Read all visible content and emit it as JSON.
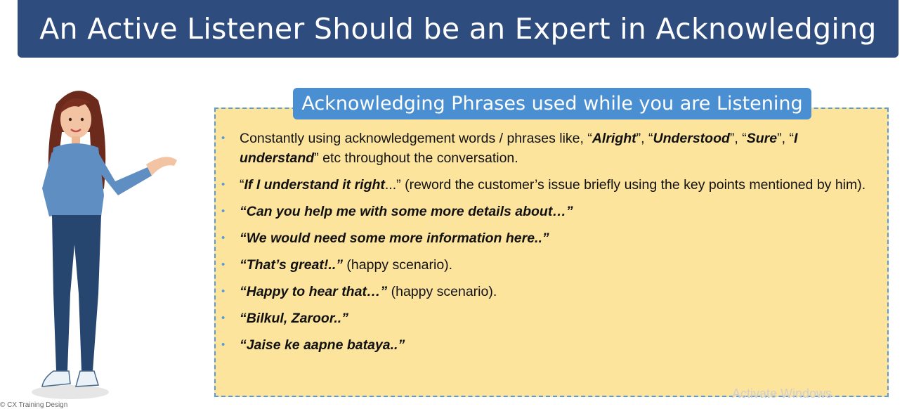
{
  "slide": {
    "title": "An Active Listener Should be an Expert in Acknowledging",
    "section_header": "Acknowledging Phrases used while you are Listening"
  },
  "phrases": [
    {
      "runs": [
        {
          "t": "Constantly using acknowledgement words / phrases like, “"
        },
        {
          "t": "Alright",
          "b": true
        },
        {
          "t": "”, “"
        },
        {
          "t": "Understood",
          "b": true
        },
        {
          "t": "”, “"
        },
        {
          "t": "Sure",
          "b": true
        },
        {
          "t": "”, “"
        },
        {
          "t": "I understand",
          "b": true
        },
        {
          "t": "” etc throughout the conversation."
        }
      ]
    },
    {
      "runs": [
        {
          "t": "“"
        },
        {
          "t": "If I understand it right",
          "b": true
        },
        {
          "t": "...” (reword the customer’s issue briefly using the key points mentioned by him)."
        }
      ]
    },
    {
      "runs": [
        {
          "t": "“Can you help me with some more details about…”",
          "b": true
        }
      ]
    },
    {
      "runs": [
        {
          "t": "“We would need some more information here..”",
          "b": true
        }
      ]
    },
    {
      "runs": [
        {
          "t": "“That’s great!..”",
          "b": true
        },
        {
          "t": " (happy scenario)."
        }
      ]
    },
    {
      "runs": [
        {
          "t": "“Happy to hear that…”",
          "b": true
        },
        {
          "t": " (happy scenario)."
        }
      ]
    },
    {
      "runs": [
        {
          "t": "“Bilkul, Zaroor..”",
          "b": true
        }
      ]
    },
    {
      "runs": [
        {
          "t": "“Jaise ke aapne bataya..”",
          "b": true
        }
      ]
    }
  ],
  "footer": {
    "copyright": "© CX Training Design",
    "watermark": "Activate Windows"
  },
  "colors": {
    "title_bg": "#2f4c7e",
    "header_bg": "#4a8fd2",
    "box_bg": "#fde49d",
    "box_border": "#5b9bd5",
    "bullet": "#5b9bd5"
  }
}
